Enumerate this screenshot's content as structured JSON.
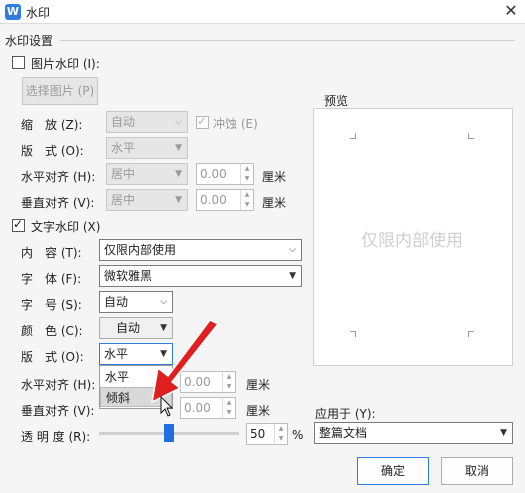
{
  "window": {
    "title": "水印",
    "close_icon": "✕"
  },
  "section_title": "水印设置",
  "picture": {
    "checkbox_label": "图片水印 (I):",
    "select_button": "选择图片 (P)",
    "scale_label": "缩　放 (Z):",
    "scale_value": "自动",
    "washout_label": "冲蚀 (E)",
    "layout_label": "版　式 (O):",
    "layout_value": "水平",
    "halign_label": "水平对齐 (H):",
    "halign_value": "居中",
    "halign_offset": "0.00",
    "valign_label": "垂直对齐 (V):",
    "valign_value": "居中",
    "valign_offset": "0.00",
    "unit": "厘米"
  },
  "text": {
    "checkbox_label": "文字水印 (X)",
    "content_label": "内　容 (T):",
    "content_value": "仅限内部使用",
    "font_label": "字　体 (F):",
    "font_value": "微软雅黑",
    "size_label": "字　号 (S):",
    "size_value": "自动",
    "color_label": "颜　色 (C):",
    "color_value": "自动",
    "layout_label": "版　式 (O):",
    "layout_value": "水平",
    "layout_options": [
      "水平",
      "倾斜"
    ],
    "halign_label": "水平对齐 (H):",
    "halign_offset": "0.00",
    "valign_label": "垂直对齐 (V):",
    "valign_offset": "0.00",
    "unit": "厘米",
    "transparency_label": "透 明 度 (R):",
    "transparency_value": "50",
    "transparency_unit": "%",
    "transparency_level": 0.5
  },
  "preview": {
    "label": "预览",
    "watermark_text": "仅限内部使用"
  },
  "apply": {
    "label": "应用于 (Y):",
    "value": "整篇文档"
  },
  "buttons": {
    "ok": "确定",
    "cancel": "取消"
  },
  "colors": {
    "accent": "#2f7de1",
    "annotation_arrow": "#e02020"
  }
}
